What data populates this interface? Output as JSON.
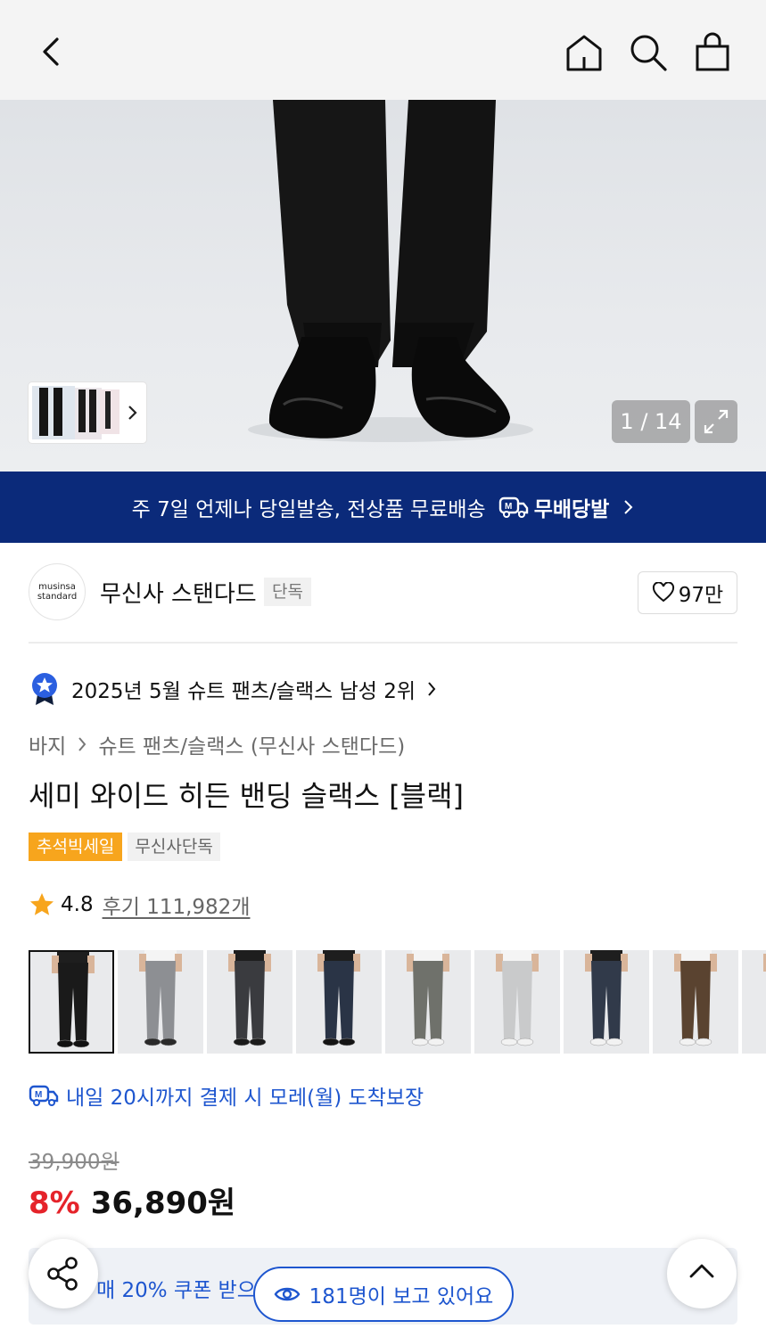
{
  "header": {
    "back_icon": "chevron-left-icon",
    "home_icon": "home-icon",
    "search_icon": "search-icon",
    "cart_icon": "shopping-bag-icon"
  },
  "gallery": {
    "counter": "1 / 14",
    "expand_icon": "expand-icon"
  },
  "banner": {
    "text": "주 7일 언제나 당일발송, 전상품 무료배송",
    "brand": "무배당발"
  },
  "brand": {
    "logo_line1": "musinsa",
    "logo_line2": "standard",
    "name": "무신사 스탠다드",
    "exclusive_badge": "단독",
    "like_count": "97만"
  },
  "ranking": {
    "text": "2025년 5월 슈트 팬츠/슬랙스 남성 2위"
  },
  "breadcrumb": {
    "level1": "바지",
    "level2": "슈트 팬츠/슬랙스 (무신사 스탠다드)"
  },
  "product": {
    "title": "세미 와이드 히든 밴딩 슬랙스 [블랙]",
    "tags": [
      "추석빅세일",
      "무신사단독"
    ],
    "rating": "4.8",
    "reviews": "후기 111,982개",
    "delivery": "내일 20시까지 결제 시 모레(월) 도착보장",
    "original_price": "39,900원",
    "discount": "8%",
    "price": "36,890원"
  },
  "colors": {
    "swatches": [
      {
        "name": "블랙",
        "pants": "#1a1a1a",
        "shoes": "#111111"
      },
      {
        "name": "그레이",
        "pants": "#8d8f93",
        "shoes": "#2a2a2a"
      },
      {
        "name": "차콜",
        "pants": "#3a3b3f",
        "shoes": "#1b1b1b"
      },
      {
        "name": "네이비",
        "pants": "#2a3446",
        "shoes": "#141414"
      },
      {
        "name": "카키그레이",
        "pants": "#6f716b",
        "shoes": "#f2f2f2"
      },
      {
        "name": "라이트그레이",
        "pants": "#c9cacb",
        "shoes": "#f2f2f2"
      },
      {
        "name": "다크네이비",
        "pants": "#313a4a",
        "shoes": "#f2f2f2"
      },
      {
        "name": "브라운",
        "pants": "#5a4330",
        "shoes": "#f2f2f2"
      },
      {
        "name": "기타",
        "pants": "#8a8a8a",
        "shoes": "#f2f2f2"
      }
    ]
  },
  "bottom": {
    "coupon_text": "매 20% 쿠폰 받으",
    "viewers": "181명이 보고 있어요",
    "share_icon": "share-icon",
    "top_icon": "chevron-up-icon"
  }
}
